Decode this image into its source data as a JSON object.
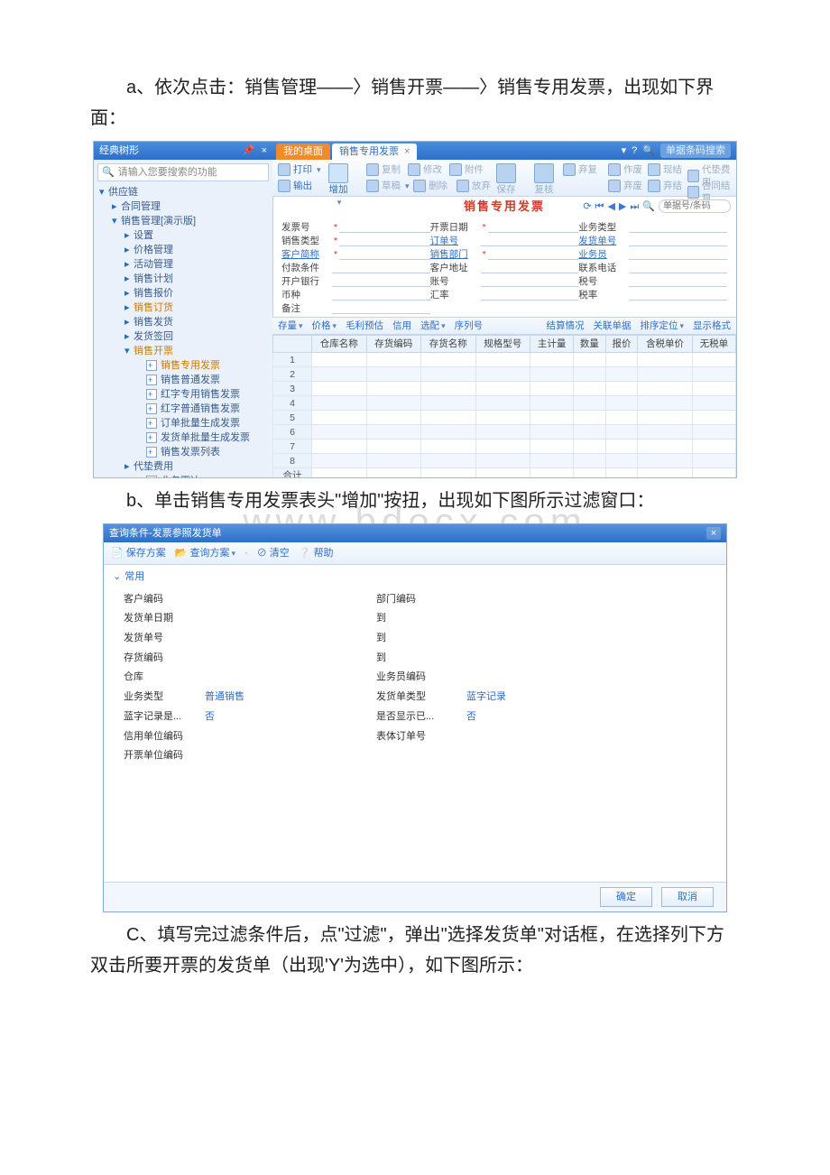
{
  "doc": {
    "para_a": "a、依次点击：销售管理——〉销售开票——〉销售专用发票，出现如下界面：",
    "para_b": "b、单击销售专用发票表头\"增加\"按扭，出现如下图所示过滤窗口：",
    "para_c": "C、填写完过滤条件后，点\"过滤\"，弹出\"选择发货单\"对话框，在选择列下方双击所要开票的发货单（出现'Y'为选中），如下图所示：",
    "watermark": "www.bdocx.com"
  },
  "shot1": {
    "sidebar": {
      "title": "经典树形",
      "pin": "📌",
      "close": "×",
      "search_placeholder": "请输入您要搜索的功能",
      "tree": [
        {
          "lvl": 0,
          "arr": "▾",
          "name": "供应链",
          "leaf": false
        },
        {
          "lvl": 1,
          "arr": "▸",
          "name": "合同管理",
          "leaf": false
        },
        {
          "lvl": 1,
          "arr": "▾",
          "name": "销售管理[演示版]",
          "leaf": false,
          "sel": false
        },
        {
          "lvl": 2,
          "arr": "▸",
          "name": "设置",
          "leaf": false
        },
        {
          "lvl": 2,
          "arr": "▸",
          "name": "价格管理",
          "leaf": false
        },
        {
          "lvl": 2,
          "arr": "▸",
          "name": "活动管理",
          "leaf": false
        },
        {
          "lvl": 2,
          "arr": "▸",
          "name": "销售计划",
          "leaf": false
        },
        {
          "lvl": 2,
          "arr": "▸",
          "name": "销售报价",
          "leaf": false
        },
        {
          "lvl": 2,
          "arr": "▸",
          "name": "销售订货",
          "leaf": false,
          "sel": true
        },
        {
          "lvl": 2,
          "arr": "▸",
          "name": "销售发货",
          "leaf": false
        },
        {
          "lvl": 2,
          "arr": "▸",
          "name": "发货签回",
          "leaf": false
        },
        {
          "lvl": 2,
          "arr": "▾",
          "name": "销售开票",
          "leaf": false,
          "sel": true
        },
        {
          "lvl": 3,
          "arr": "",
          "name": "销售专用发票",
          "leaf": true,
          "sel": true
        },
        {
          "lvl": 3,
          "arr": "",
          "name": "销售普通发票",
          "leaf": true
        },
        {
          "lvl": 3,
          "arr": "",
          "name": "红字专用销售发票",
          "leaf": true
        },
        {
          "lvl": 3,
          "arr": "",
          "name": "红字普通销售发票",
          "leaf": true
        },
        {
          "lvl": 3,
          "arr": "",
          "name": "订单批量生成发票",
          "leaf": true
        },
        {
          "lvl": 3,
          "arr": "",
          "name": "发货单批量生成发票",
          "leaf": true
        },
        {
          "lvl": 3,
          "arr": "",
          "name": "销售发票列表",
          "leaf": true
        },
        {
          "lvl": 2,
          "arr": "▸",
          "name": "代垫费用",
          "leaf": false
        },
        {
          "lvl": 3,
          "arr": "",
          "name": "业务下达",
          "leaf": true
        }
      ]
    },
    "tabs": {
      "home": "我的桌面",
      "current": "销售专用发票",
      "close": "×",
      "help": "?",
      "search_icon": "🔍",
      "search_placeholder": "单据条码搜索"
    },
    "toolbar": {
      "print": "打印",
      "output": "输出",
      "add": "增加",
      "copy": "复制",
      "edit": "修改",
      "attach": "附件",
      "draft": "草稿",
      "delete": "删除",
      "discard": "放弃",
      "save": "保存",
      "reply": "弃复",
      "review": "复核",
      "void": "作废",
      "void2": "弃废",
      "cash": "现结",
      "cash2": "弃结",
      "advance": "代垫费用",
      "settle": "合同结算"
    },
    "title": "销售专用发票",
    "title_nav": {
      "refresh": "⟳",
      "first": "⏮",
      "prev": "◀",
      "next": "▶",
      "last": "⏭",
      "search_placeholder": "单据号/条码"
    },
    "form": {
      "rows": [
        [
          {
            "label": "发票号",
            "star": true,
            "blue": false
          },
          {
            "label": "开票日期",
            "star": true,
            "blue": false
          },
          {
            "label": "业务类型",
            "star": false,
            "blue": false
          }
        ],
        [
          {
            "label": "销售类型",
            "star": true,
            "blue": false
          },
          {
            "label": "订单号",
            "star": false,
            "blue": true
          },
          {
            "label": "发货单号",
            "star": false,
            "blue": true
          }
        ],
        [
          {
            "label": "客户简称",
            "star": true,
            "blue": true
          },
          {
            "label": "销售部门",
            "star": true,
            "blue": true
          },
          {
            "label": "业务员",
            "star": false,
            "blue": true
          }
        ],
        [
          {
            "label": "付款条件",
            "star": false,
            "blue": false
          },
          {
            "label": "客户地址",
            "star": false,
            "blue": false
          },
          {
            "label": "联系电话",
            "star": false,
            "blue": false
          }
        ],
        [
          {
            "label": "开户银行",
            "star": false,
            "blue": false
          },
          {
            "label": "账号",
            "star": false,
            "blue": false
          },
          {
            "label": "税号",
            "star": false,
            "blue": false
          }
        ],
        [
          {
            "label": "币种",
            "star": false,
            "blue": false
          },
          {
            "label": "汇率",
            "star": false,
            "blue": false
          },
          {
            "label": "税率",
            "star": false,
            "blue": false
          }
        ],
        [
          {
            "label": "备注",
            "star": false,
            "blue": false
          }
        ]
      ]
    },
    "gridbar": {
      "inventory": "存量",
      "price": "价格",
      "gross": "毛利预估",
      "credit": "信用",
      "match": "选配",
      "serial": "序列号",
      "settle": "结算情况",
      "link": "关联单据",
      "sort": "排序定位",
      "format": "显示格式"
    },
    "grid": {
      "cols": [
        "仓库名称",
        "存货编码",
        "存货名称",
        "规格型号",
        "主计量",
        "数量",
        "报价",
        "含税单价",
        "无税单"
      ],
      "rows": 8,
      "total": "合计"
    }
  },
  "shot2": {
    "title": "查询条件-发票参照发货单",
    "tools": {
      "save": "保存方案",
      "query": "查询方案",
      "dot": "·",
      "clear": "清空",
      "help": "帮助"
    },
    "section": "常用",
    "fields": {
      "left": [
        {
          "label": "客户编码",
          "val": ""
        },
        {
          "label": "发货单日期",
          "val": ""
        },
        {
          "label": "发货单号",
          "val": ""
        },
        {
          "label": "存货编码",
          "val": ""
        },
        {
          "label": "仓库",
          "val": ""
        },
        {
          "label": "业务类型",
          "val": "普通销售"
        },
        {
          "label": "蓝字记录是...",
          "val": "否"
        },
        {
          "label": "信用单位编码",
          "val": ""
        },
        {
          "label": "开票单位编码",
          "val": ""
        }
      ],
      "right": [
        {
          "label": "部门编码",
          "val": ""
        },
        {
          "label": "到",
          "val": ""
        },
        {
          "label": "到",
          "val": ""
        },
        {
          "label": "到",
          "val": ""
        },
        {
          "label": "业务员编码",
          "val": ""
        },
        {
          "label": "发货单类型",
          "val": "蓝字记录"
        },
        {
          "label": "是否显示已...",
          "val": "否"
        },
        {
          "label": "表体订单号",
          "val": ""
        }
      ]
    },
    "footer": {
      "ok": "确定",
      "cancel": "取消"
    }
  }
}
